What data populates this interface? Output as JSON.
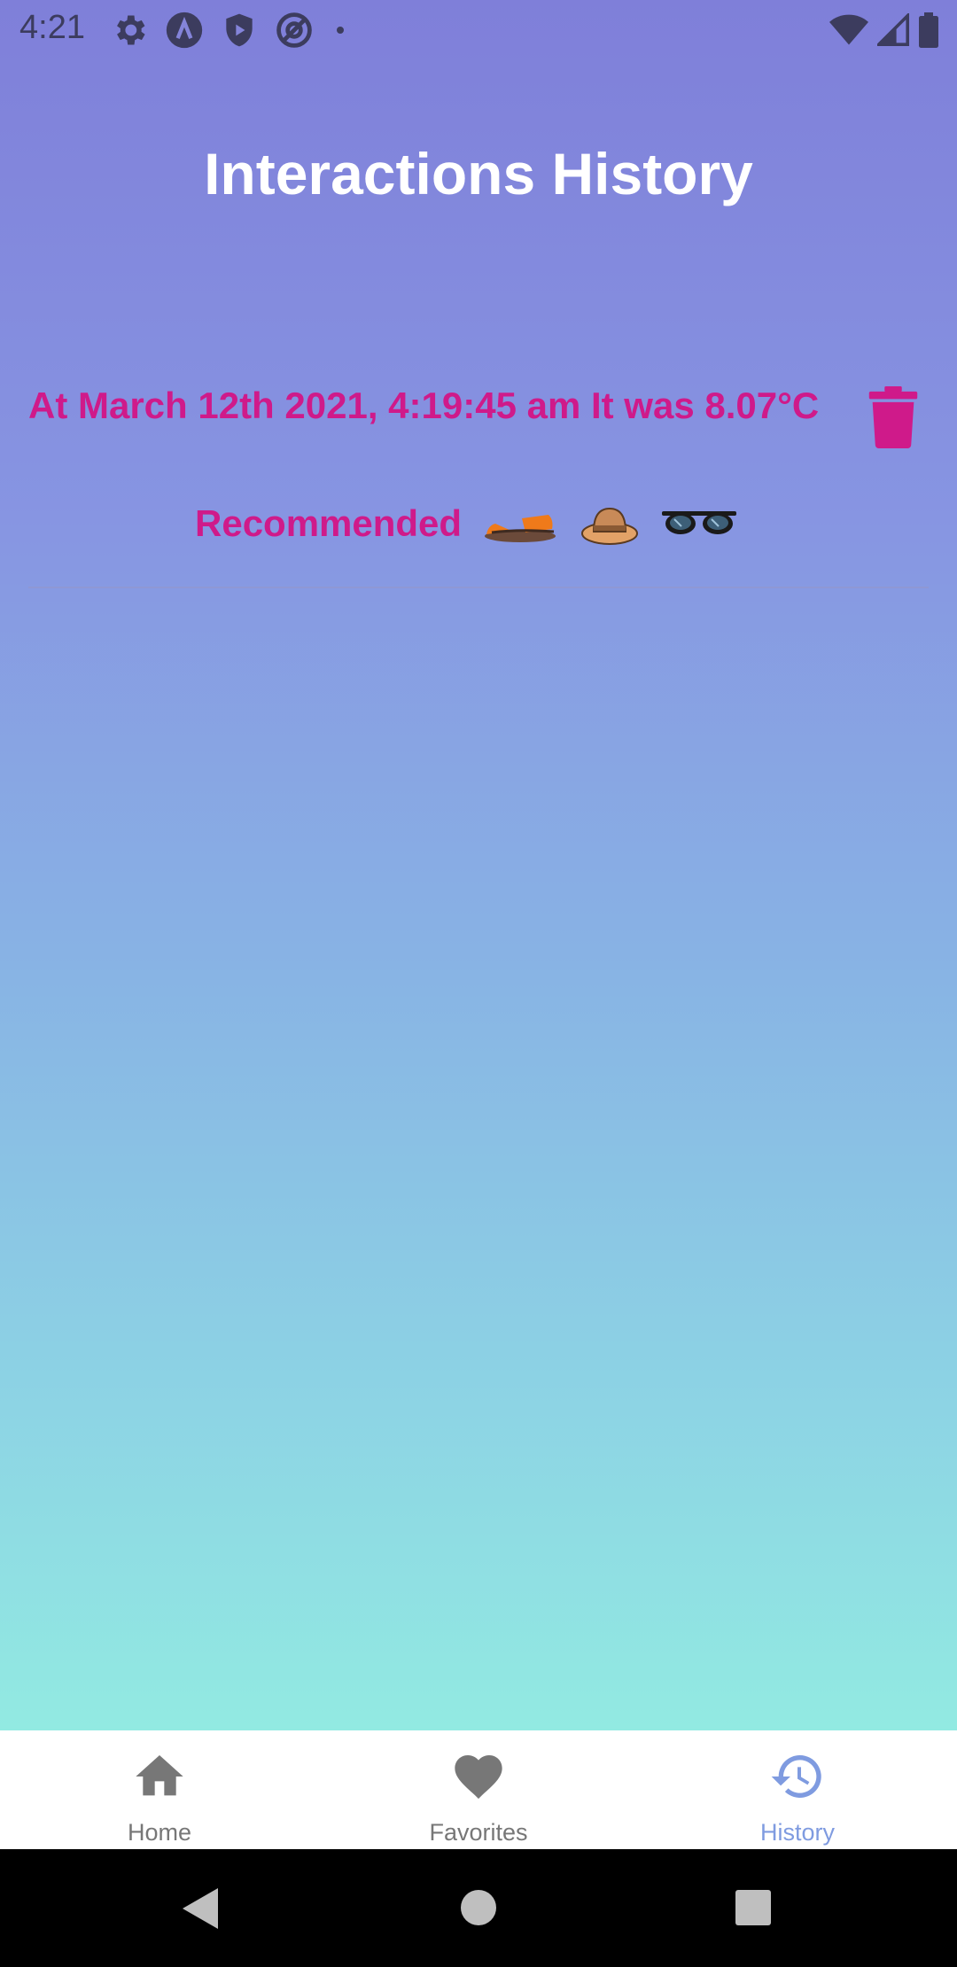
{
  "status_bar": {
    "time": "4:21",
    "left_icons": [
      "gear-icon",
      "app-lambda-icon",
      "shield-play-icon",
      "at-sign-icon",
      "dot-icon"
    ],
    "right_icons": [
      "wifi-icon",
      "signal-icon",
      "battery-icon"
    ]
  },
  "page": {
    "title": "Interactions History"
  },
  "history": {
    "entries": [
      {
        "text": "At March 12th 2021, 4:19:45 am It was 8.07°C",
        "recommended_label": "Recommended",
        "recommended_items": [
          "sandal-icon",
          "hat-icon",
          "sunglasses-icon"
        ]
      }
    ]
  },
  "bottom_nav": {
    "items": [
      {
        "label": "Home",
        "icon": "home-icon",
        "active": false
      },
      {
        "label": "Favorites",
        "icon": "heart-icon",
        "active": false
      },
      {
        "label": "History",
        "icon": "history-icon",
        "active": true
      }
    ]
  },
  "colors": {
    "accent_pink": "#cf1a8a",
    "active_tab": "#7f9be0",
    "inactive_tab": "#777777",
    "gradient_top": "#7f7fd9",
    "gradient_bottom": "#92eae2"
  }
}
